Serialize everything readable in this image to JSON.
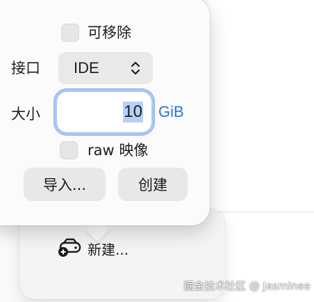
{
  "popover": {
    "removable_label": "可移除",
    "interface_label": "接口",
    "interface_value": "IDE",
    "size_label": "大小",
    "size_value": "10",
    "size_unit": "GiB",
    "raw_label": "raw 映像",
    "import_button": "导入...",
    "create_button": "创建"
  },
  "under_panel": {
    "new_label": "新建..."
  },
  "watermark": "掘金技术社区 @ Jasminee",
  "colors": {
    "accent_blue": "#2f74d6",
    "focus_ring": "#a9c6f4",
    "selection": "#b7d0f6"
  },
  "icons": {
    "chevron": "updown-chevron-icon",
    "new_disk": "add-disk-icon"
  }
}
